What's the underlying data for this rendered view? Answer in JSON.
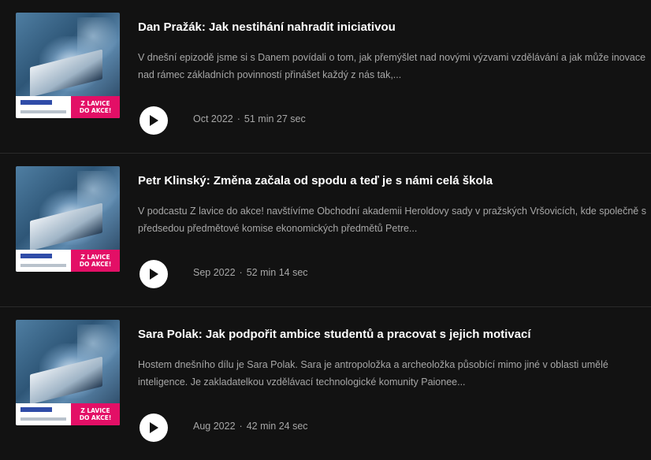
{
  "episodes": [
    {
      "title": "Dan Pražák: Jak nestihání nahradit iniciativou",
      "description": "V dnešní epizodě jsme si s Danem povídali o tom, jak přemýšlet nad novými výzvami vzdělávání a jak může inovace nad rámec základních povinností přinášet každý z nás tak,...",
      "date": "Oct 2022",
      "duration": "51 min 27 sec",
      "cover_badge": [
        "Z LAVICE",
        "DO AKCE!"
      ]
    },
    {
      "title": "Petr Klinský: Změna začala od spodu a teď je s námi celá škola",
      "description": "V podcastu Z lavice do akce! navštívíme Obchodní akademii Heroldovy sady v pražských Vršovicích, kde společně s předsedou předmětové komise ekonomických předmětů Petre...",
      "date": "Sep 2022",
      "duration": "52 min 14 sec",
      "cover_badge": [
        "Z LAVICE",
        "DO AKCE!"
      ]
    },
    {
      "title": "Sara Polak: Jak podpořit ambice studentů a pracovat s jejich motivací",
      "description": "Hostem dnešního dílu je Sara Polak. Sara je antropoložka a archeoložka působící mimo jiné v oblasti umělé inteligence. Je zakladatelkou vzdělávací technologické komunity Paionee...",
      "date": "Aug 2022",
      "duration": "42 min 24 sec",
      "cover_badge": [
        "Z LAVICE",
        "DO AKCE!"
      ]
    }
  ],
  "meta_separator": "·",
  "colors": {
    "background": "#121212",
    "title": "#ffffff",
    "secondary_text": "#a7a7a7",
    "badge": "#e30f66",
    "play_button": "#ffffff"
  },
  "icons": {
    "play": "play-icon"
  }
}
